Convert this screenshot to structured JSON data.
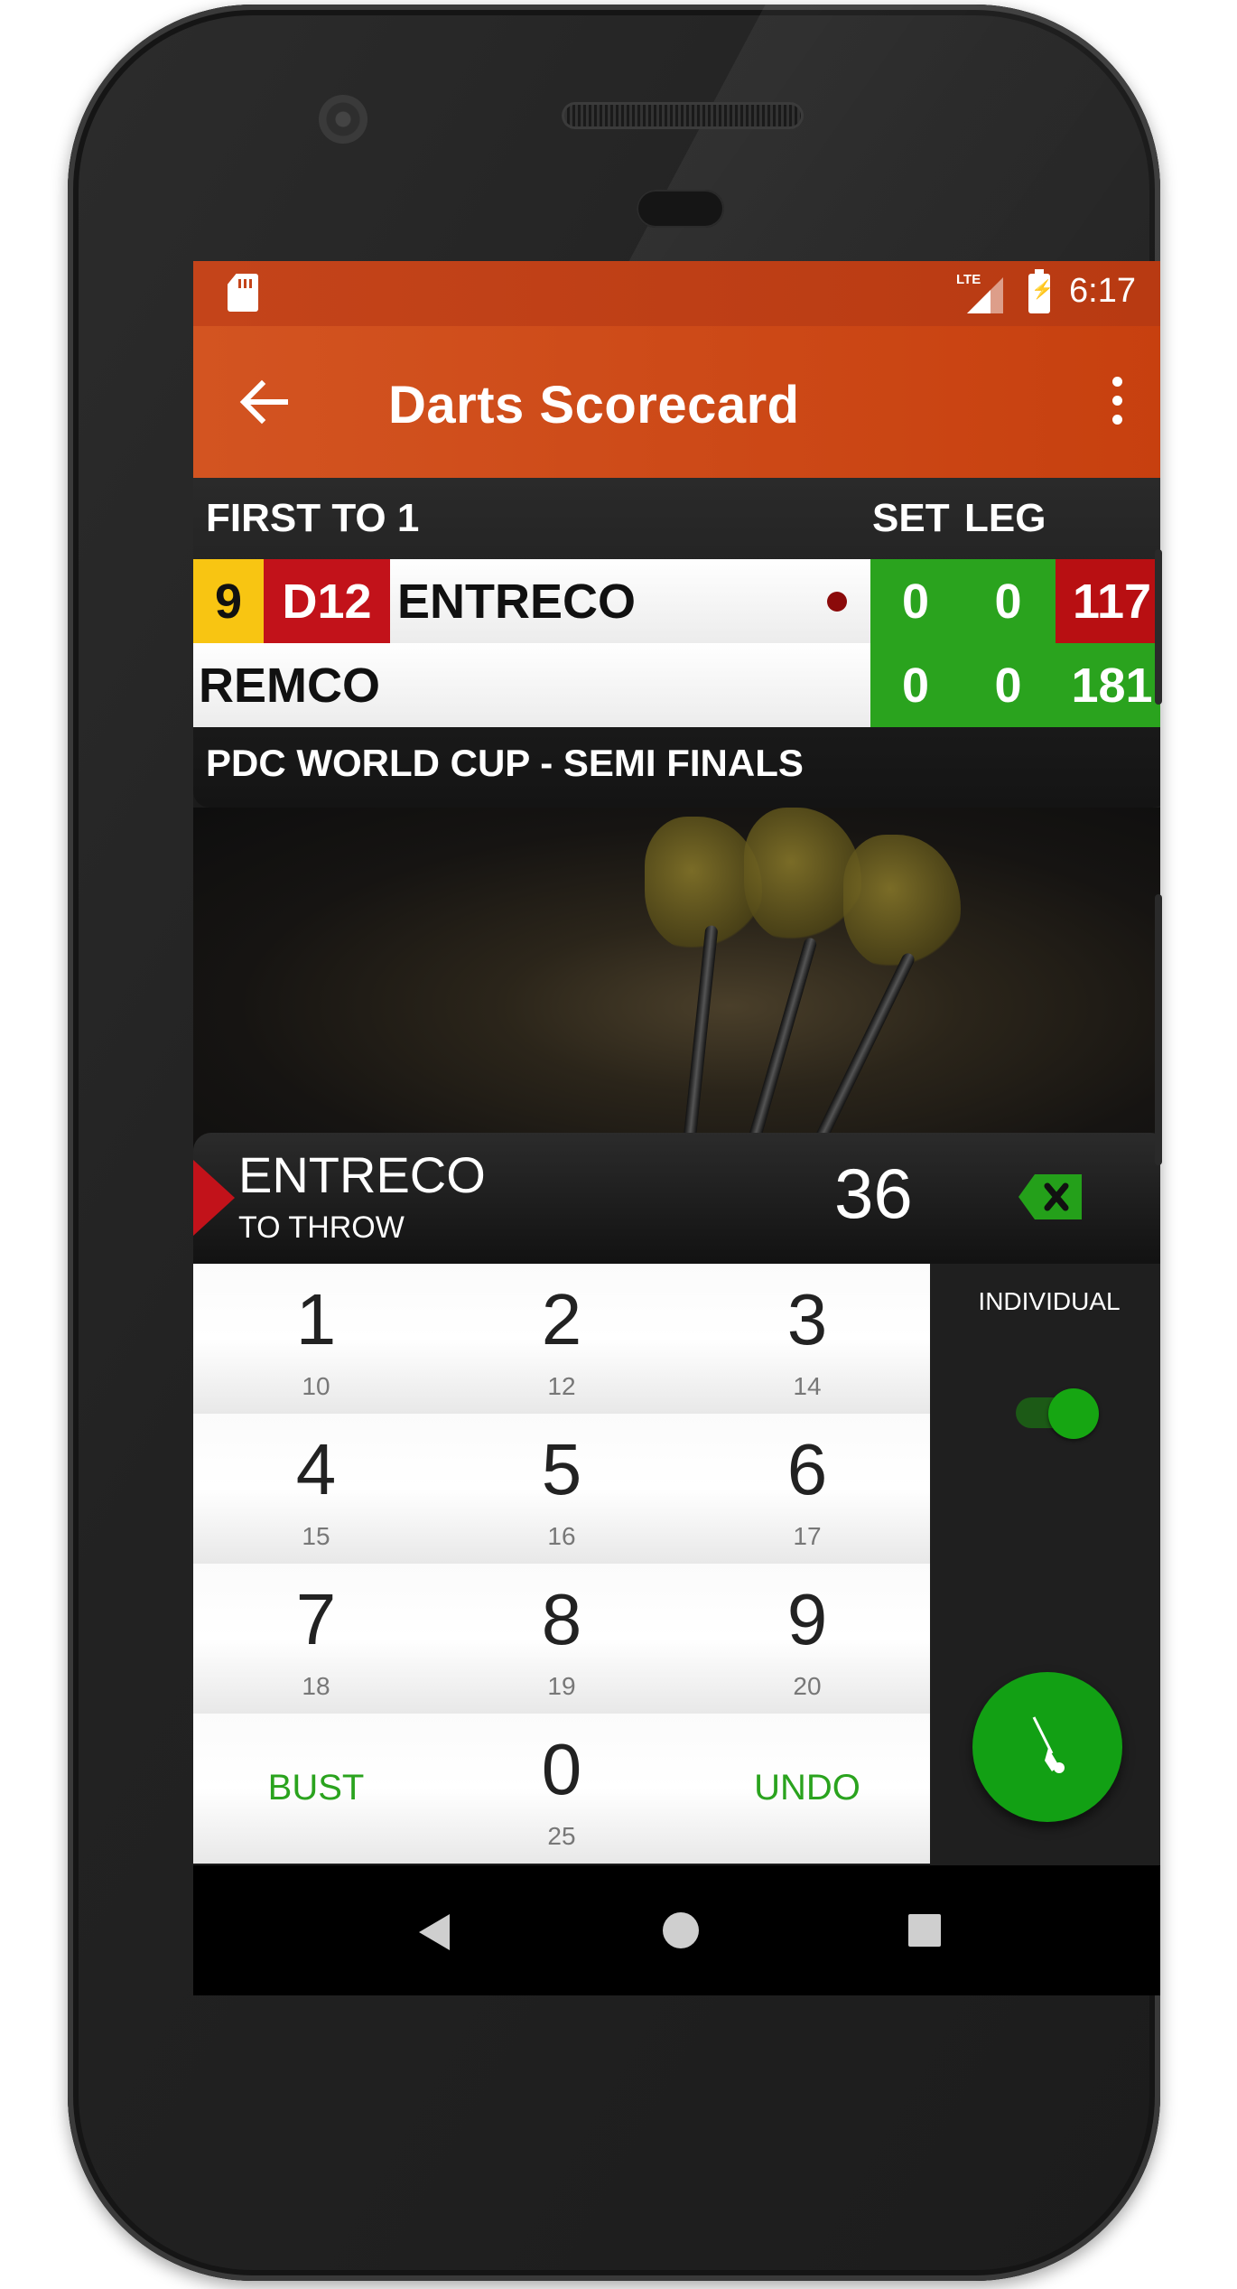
{
  "status_bar": {
    "network_label": "LTE",
    "time": "6:17"
  },
  "app_bar": {
    "title": "Darts Scorecard"
  },
  "scoreboard": {
    "format": "FIRST TO 1",
    "set_header": "SET",
    "leg_header": "LEG",
    "players": [
      {
        "darts_left": "9",
        "checkout": "D12",
        "name": "ENTRECO",
        "sets": "0",
        "legs": "0",
        "score": "117",
        "to_throw": true
      },
      {
        "name": "REMCO",
        "sets": "0",
        "legs": "0",
        "score": "181",
        "to_throw": false
      }
    ],
    "event": "PDC WORLD CUP - SEMI FINALS"
  },
  "throw_panel": {
    "player": "ENTRECO",
    "subtitle": "TO THROW",
    "value": "36"
  },
  "keypad": {
    "keys": [
      {
        "num": "1",
        "sub": "10"
      },
      {
        "num": "2",
        "sub": "12"
      },
      {
        "num": "3",
        "sub": "14"
      },
      {
        "num": "4",
        "sub": "15"
      },
      {
        "num": "5",
        "sub": "16"
      },
      {
        "num": "6",
        "sub": "17"
      },
      {
        "num": "7",
        "sub": "18"
      },
      {
        "num": "8",
        "sub": "19"
      },
      {
        "num": "9",
        "sub": "20"
      },
      {
        "num": "0",
        "sub": "25"
      }
    ],
    "bust_label": "BUST",
    "undo_label": "UNDO"
  },
  "side_panel": {
    "mode_label": "INDIVIDUAL",
    "toggle_on": true
  },
  "icons": {
    "back": "arrow-back-icon",
    "more": "more-vert-icon",
    "backspace": "backspace-icon",
    "fab": "dart-icon"
  },
  "colors": {
    "accent": "#d35421",
    "green": "#2aa31e",
    "red": "#c2121a",
    "yellow": "#f8c512"
  }
}
